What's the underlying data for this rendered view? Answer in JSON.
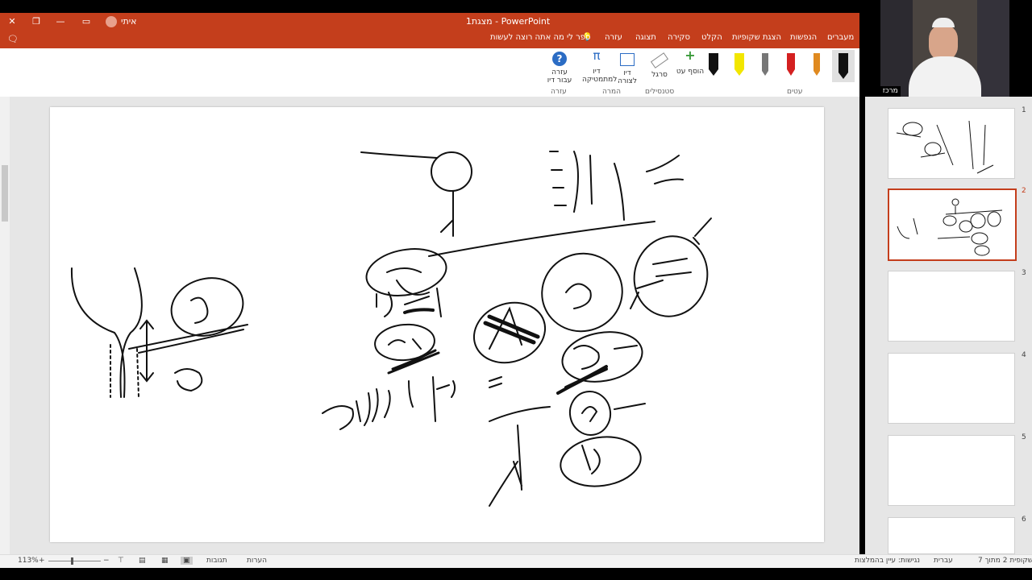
{
  "window": {
    "title": "מצגת1 - PowerPoint",
    "user": "איתי אלון",
    "close": "✕",
    "restore": "❐",
    "minimize": "—"
  },
  "tabs": [
    "מעברים",
    "הנפשות",
    "הצגת שקופיות",
    "הקלט",
    "סקירה",
    "תצוגה",
    "עזרה"
  ],
  "search_label": "ספר לי מה אתה רוצה לעשות",
  "ribbon": {
    "help_label": "עזרה עבור דיו",
    "help_group": "עזרה",
    "ink_to_math_label": "דיו למתמטיקה",
    "ink_to_shape_label": "דיו לצורה",
    "convert_group": "המרה",
    "ruler_label": "סרגל",
    "stencils_group": "סטנסילים",
    "add_pen_label": "הוסף עט",
    "pens_group": "עטים"
  },
  "slides_panel": {
    "numbers": [
      "1",
      "2",
      "3",
      "4",
      "5",
      "6"
    ],
    "selected": 2
  },
  "webcam": {
    "caption": "מרכז גופר"
  },
  "status": {
    "slide_info": "שקופית 2 מתוך 7",
    "language": "עברית",
    "accessibility": "נגישות: עיין בהמלצות",
    "notes": "הערות",
    "comments": "תגובות",
    "zoom": "113%"
  },
  "colors": {
    "accent": "#c43e1c",
    "ink": "#111111"
  }
}
